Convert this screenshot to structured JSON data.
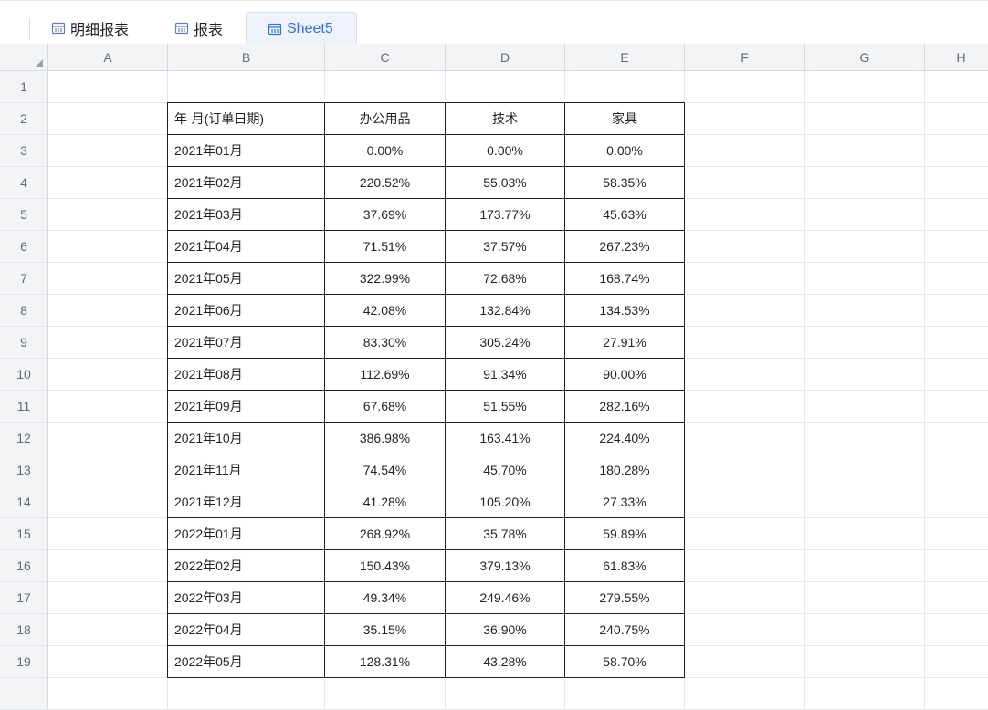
{
  "tabs": [
    {
      "label": "明细报表",
      "active": false
    },
    {
      "label": "报表",
      "active": false
    },
    {
      "label": "Sheet5",
      "active": true
    }
  ],
  "sheet": {
    "columns": [
      "A",
      "B",
      "C",
      "D",
      "E",
      "F",
      "G",
      "H"
    ],
    "row_numbers": [
      "1",
      "2",
      "3",
      "4",
      "5",
      "6",
      "7",
      "8",
      "9",
      "10",
      "11",
      "12",
      "13",
      "14",
      "15",
      "16",
      "17",
      "18",
      "19"
    ],
    "table_header": [
      "年-月(订单日期)",
      "办公用品",
      "技术",
      "家具"
    ],
    "table_rows": [
      [
        "2021年01月",
        "0.00%",
        "0.00%",
        "0.00%"
      ],
      [
        "2021年02月",
        "220.52%",
        "55.03%",
        "58.35%"
      ],
      [
        "2021年03月",
        "37.69%",
        "173.77%",
        "45.63%"
      ],
      [
        "2021年04月",
        "71.51%",
        "37.57%",
        "267.23%"
      ],
      [
        "2021年05月",
        "322.99%",
        "72.68%",
        "168.74%"
      ],
      [
        "2021年06月",
        "42.08%",
        "132.84%",
        "134.53%"
      ],
      [
        "2021年07月",
        "83.30%",
        "305.24%",
        "27.91%"
      ],
      [
        "2021年08月",
        "112.69%",
        "91.34%",
        "90.00%"
      ],
      [
        "2021年09月",
        "67.68%",
        "51.55%",
        "282.16%"
      ],
      [
        "2021年10月",
        "386.98%",
        "163.41%",
        "224.40%"
      ],
      [
        "2021年11月",
        "74.54%",
        "45.70%",
        "180.28%"
      ],
      [
        "2021年12月",
        "41.28%",
        "105.20%",
        "27.33%"
      ],
      [
        "2022年01月",
        "268.92%",
        "35.78%",
        "59.89%"
      ],
      [
        "2022年02月",
        "150.43%",
        "379.13%",
        "61.83%"
      ],
      [
        "2022年03月",
        "49.34%",
        "249.46%",
        "279.55%"
      ],
      [
        "2022年04月",
        "35.15%",
        "36.90%",
        "240.75%"
      ],
      [
        "2022年05月",
        "128.31%",
        "43.28%",
        "58.70%"
      ]
    ]
  },
  "colors": {
    "accent": "#3370d6",
    "header_bg": "#f3f4f6",
    "active_tab_bg": "#eef3fb"
  },
  "icons": {
    "tab_icon": "table-report-icon",
    "corner": "select-all-triangle-icon"
  }
}
